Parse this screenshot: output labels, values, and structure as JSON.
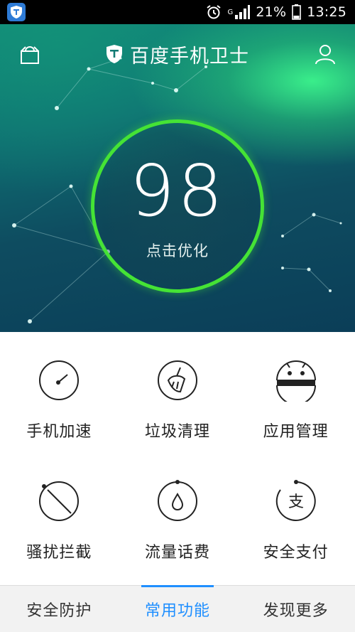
{
  "status_bar": {
    "network": "G",
    "battery": "21%",
    "time": "13:25"
  },
  "header": {
    "title": "百度手机卫士"
  },
  "score": {
    "value": "98",
    "action": "点击优化"
  },
  "features": [
    {
      "label": "手机加速",
      "icon": "speedometer-icon"
    },
    {
      "label": "垃圾清理",
      "icon": "broom-icon"
    },
    {
      "label": "应用管理",
      "icon": "android-icon"
    },
    {
      "label": "骚扰拦截",
      "icon": "block-icon"
    },
    {
      "label": "流量话费",
      "icon": "droplet-icon"
    },
    {
      "label": "安全支付",
      "icon": "pay-icon"
    }
  ],
  "tabs": [
    {
      "label": "安全防护",
      "active": false
    },
    {
      "label": "常用功能",
      "active": true
    },
    {
      "label": "发现更多",
      "active": false
    }
  ],
  "colors": {
    "ring": "#45e335",
    "active_tab": "#1f8fff"
  }
}
